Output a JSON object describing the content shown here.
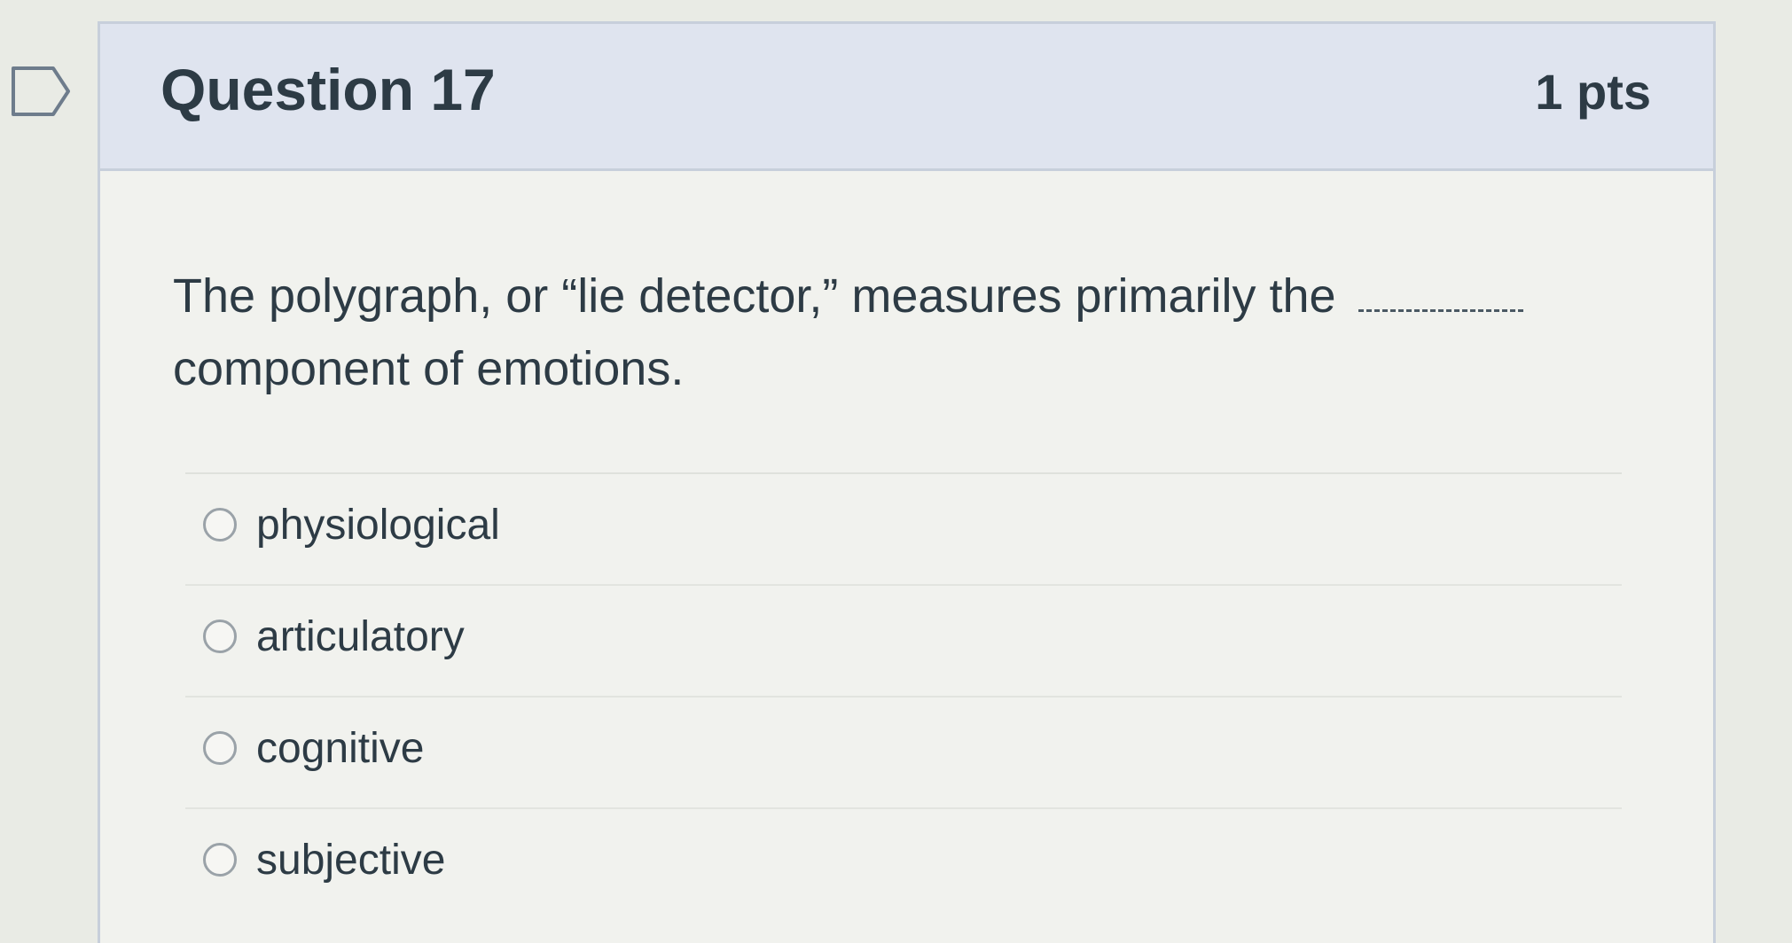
{
  "question": {
    "title": "Question 17",
    "points": "1 pts",
    "text_line1": "The polygraph, or “lie detector,” measures primarily the",
    "text_line2": "component of emotions.",
    "answers": [
      {
        "label": "physiological",
        "selected": false
      },
      {
        "label": "articulatory",
        "selected": false
      },
      {
        "label": "cognitive",
        "selected": false
      },
      {
        "label": "subjective",
        "selected": false
      }
    ]
  },
  "flag": {
    "icon": "bookmark-flag-icon"
  },
  "colors": {
    "header_background": "#dfe4ef",
    "card_background": "#f1f2ee",
    "text": "#2d3b45",
    "border": "#c7cfdb"
  }
}
